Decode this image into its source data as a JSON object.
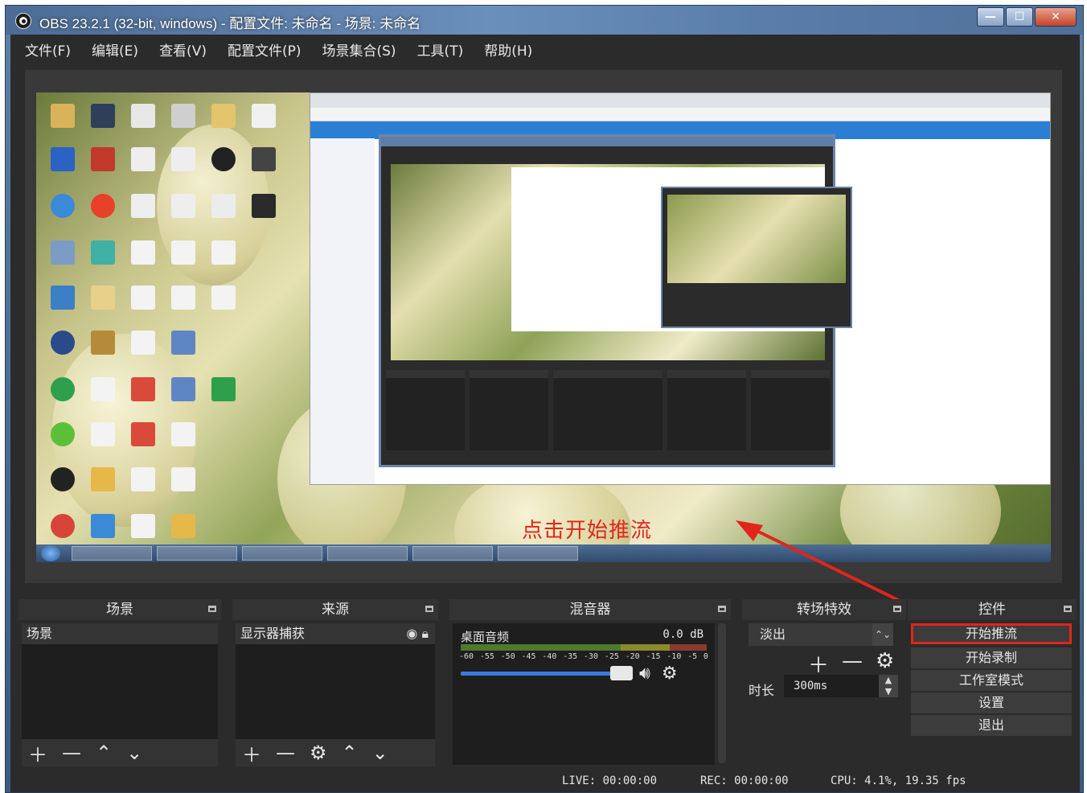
{
  "window": {
    "title": "OBS 23.2.1 (32-bit, windows) - 配置文件: 未命名 - 场景: 未命名",
    "buttons": {
      "minimize": "—",
      "maximize": "☐",
      "close": "✕"
    }
  },
  "menu": [
    "文件(F)",
    "编辑(E)",
    "查看(V)",
    "配置文件(P)",
    "场景集合(S)",
    "工具(T)",
    "帮助(H)"
  ],
  "annotation": "点击开始推流",
  "docks": {
    "scenes": {
      "title": "场景",
      "items": [
        "场景"
      ]
    },
    "sources": {
      "title": "来源",
      "items": [
        "显示器捕获"
      ]
    },
    "mixer": {
      "title": "混音器",
      "channel_name": "桌面音频",
      "db": "0.0 dB",
      "ticks": [
        "-60",
        "-55",
        "-50",
        "-45",
        "-40",
        "-35",
        "-30",
        "-25",
        "-20",
        "-15",
        "-10",
        "-5",
        "0"
      ]
    },
    "transitions": {
      "title": "转场特效",
      "selected": "淡出",
      "duration_label": "时长",
      "duration_value": "300ms"
    },
    "controls": {
      "title": "控件",
      "buttons": [
        "开始推流",
        "开始录制",
        "工作室模式",
        "设置",
        "退出"
      ]
    }
  },
  "status": {
    "live": "LIVE: 00:00:00",
    "rec": "REC: 00:00:00",
    "cpu": "CPU: 4.1%, 19.35 fps"
  },
  "colors": {
    "annotation": "#e0261a",
    "accent": "#3b7be0"
  }
}
